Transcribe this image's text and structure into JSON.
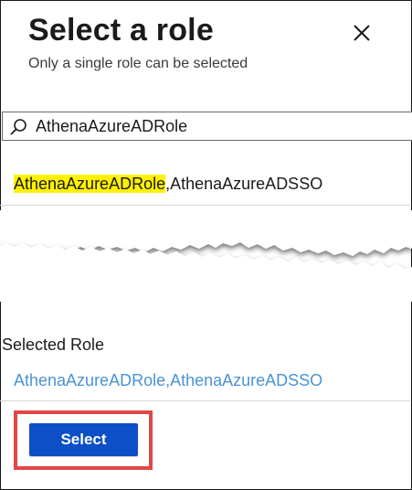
{
  "panel": {
    "title": "Select a role",
    "subtitle": "Only a single role can be selected",
    "close_icon": "close-icon"
  },
  "search": {
    "value": "AthenaAzureADRole",
    "icon": "search-icon"
  },
  "results": [
    {
      "match": "AthenaAzureADRole",
      "rest": ",AthenaAzureADSSO",
      "highlight_color": "#fff100"
    }
  ],
  "selected": {
    "label": "Selected Role",
    "value": "AthenaAzureADRole,AthenaAzureADSSO",
    "value_color": "#4a93d4"
  },
  "footer": {
    "select_label": "Select",
    "button_color": "#0d4fc7",
    "callout_color": "#e04848"
  }
}
